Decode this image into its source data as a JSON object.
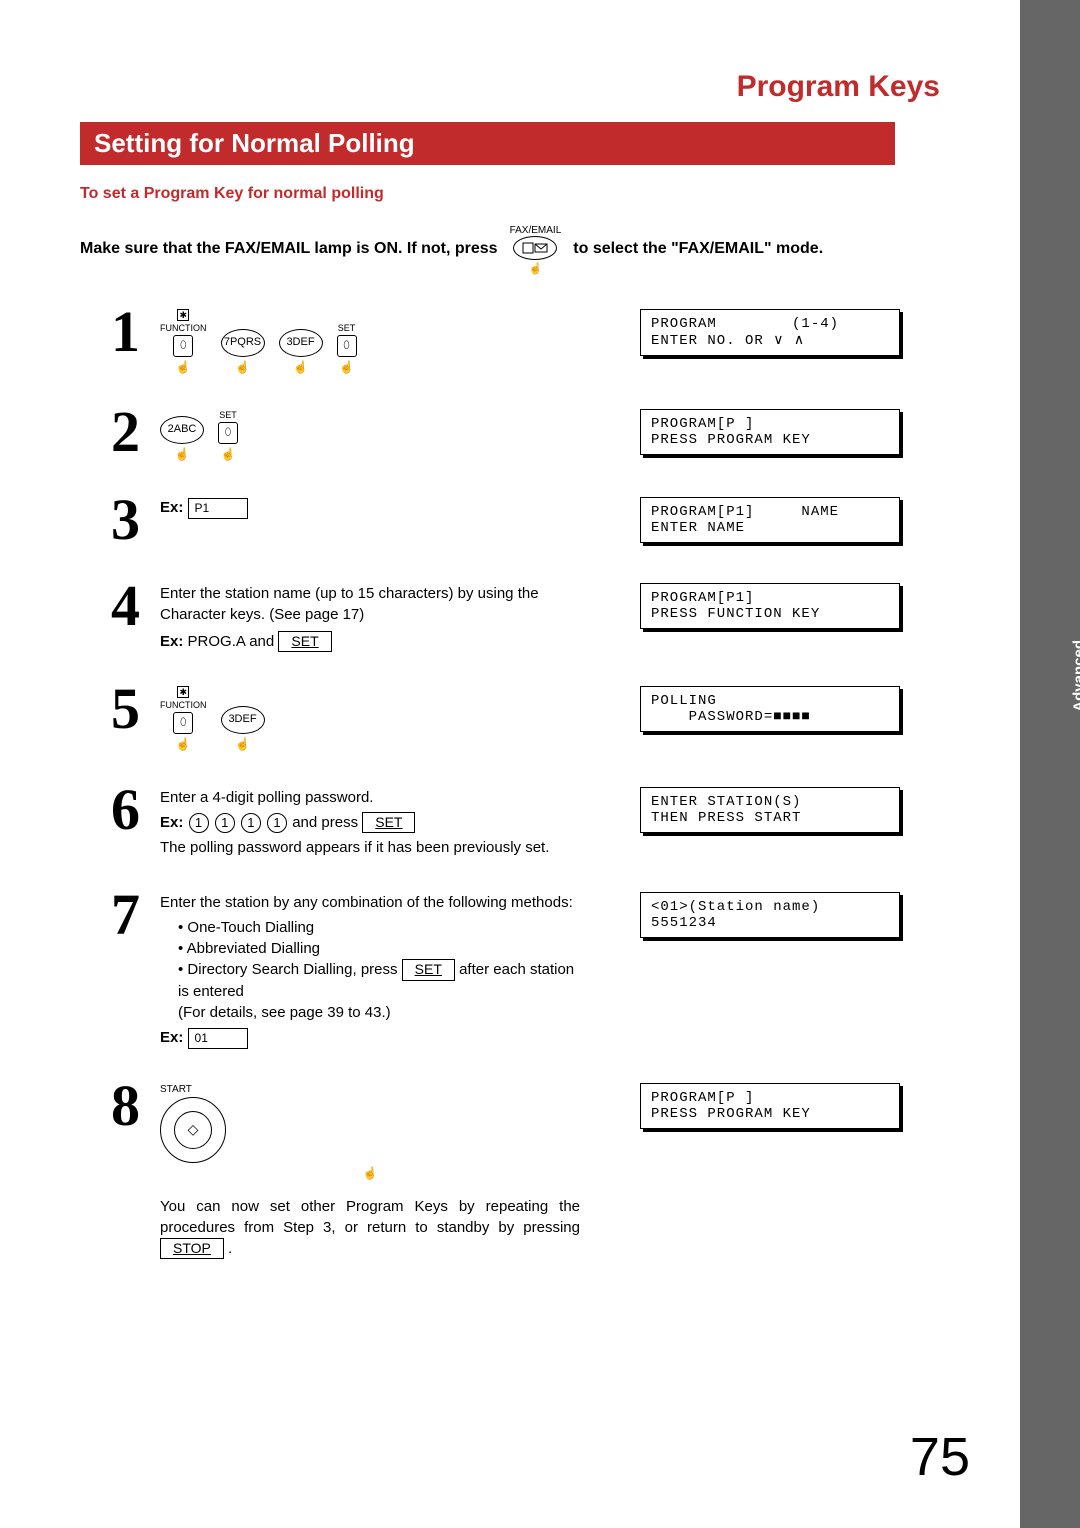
{
  "page_title": "Program Keys",
  "section_title": "Setting for Normal Polling",
  "side_tab": "Advanced\nFeatures",
  "intro_red": "To set a Program Key for normal polling",
  "intro": {
    "part1": "Make sure that the FAX/EMAIL lamp is ON.  If not, press",
    "fax_label": "FAX/EMAIL",
    "part2": "to select the \"FAX/EMAIL\" mode."
  },
  "labels": {
    "function": "FUNCTION",
    "set": "SET",
    "start": "START",
    "stop": "STOP",
    "set_btn": "SET",
    "ex": "Ex:"
  },
  "keys": {
    "k7": "7PQRS",
    "k3": "3DEF",
    "k2": "2ABC"
  },
  "steps": {
    "s1": {
      "num": "1",
      "lcd": "PROGRAM        (1-4)\nENTER NO. OR ∨ ∧"
    },
    "s2": {
      "num": "2",
      "lcd": "PROGRAM[P ]\nPRESS PROGRAM KEY"
    },
    "s3": {
      "num": "3",
      "ex_value": "P1",
      "lcd": "PROGRAM[P1]     NAME\nENTER NAME"
    },
    "s4": {
      "num": "4",
      "line1": "Enter the station name (up to 15 characters) by using the Character keys.  (See page 17)",
      "ex_prefix": "PROG.A and",
      "lcd": "PROGRAM[P1]\nPRESS FUNCTION KEY"
    },
    "s5": {
      "num": "5",
      "lcd": "POLLING\n    PASSWORD=■■■■"
    },
    "s6": {
      "num": "6",
      "line1": "Enter a 4-digit polling password.",
      "digits": [
        "1",
        "1",
        "1",
        "1"
      ],
      "and_press": " and press ",
      "line3": "The polling password appears if it has been previously set.",
      "lcd": "ENTER STATION(S)\nTHEN PRESS START"
    },
    "s7": {
      "num": "7",
      "line1": "Enter the station by any combination of the following methods:",
      "m1": "One-Touch Dialling",
      "m2": "Abbreviated Dialling",
      "m3a": "Directory Search Dialling, press ",
      "m3b": " after each station is entered",
      "m3c": "(For details, see page 39 to 43.)",
      "ex_value": "01",
      "lcd": "<01>(Station name)\n5551234"
    },
    "s8": {
      "num": "8",
      "after": "You can now set other Program Keys by repeating the procedures from Step 3, or return to standby by pressing",
      "lcd": "PROGRAM[P ]\nPRESS PROGRAM KEY"
    }
  },
  "page_number": "75"
}
